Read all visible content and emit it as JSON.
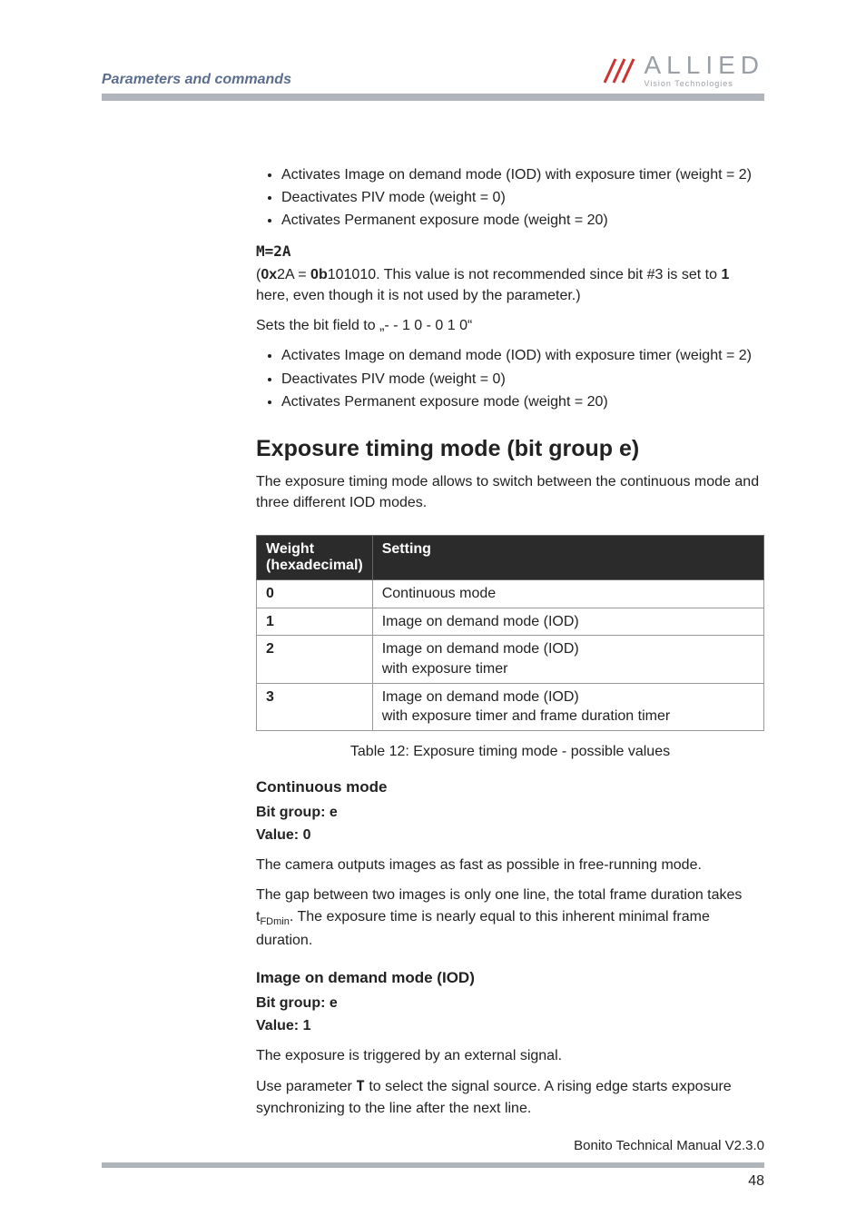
{
  "header": {
    "section": "Parameters and commands",
    "logo_top": "ALLIED",
    "logo_sub": "Vision Technologies"
  },
  "lists": {
    "top": [
      "Activates Image on demand mode (IOD) with exposure timer (weight = 2)",
      "Deactivates PIV mode (weight = 0)",
      "Activates Permanent exposure mode (weight = 20)"
    ],
    "second": [
      "Activates Image on demand mode (IOD) with exposure timer (weight = 2)",
      "Deactivates PIV mode (weight = 0)",
      "Activates Permanent exposure mode (weight = 20)"
    ]
  },
  "m2a": {
    "label": "M=2A",
    "note_pre": "(",
    "note_hex_prefix": "0x",
    "note_hex_rest": "2A = ",
    "note_bin_prefix": "0b",
    "note_bin_rest": "101010. This value is not recommended since bit #3 is set to ",
    "note_one": "1",
    "note_tail": " here, even though it is not used by the parameter.)",
    "sets": "Sets the bit field to „- - 1 0 - 0 1 0“"
  },
  "h2": "Exposure timing mode (bit group e)",
  "h2_desc": "The exposure timing mode allows to switch between the continuous mode and three different IOD modes.",
  "table": {
    "col1_a": "Weight",
    "col1_b": "(hexadecimal)",
    "col2": "Setting",
    "rows": [
      {
        "w": "0",
        "s": "Continuous mode"
      },
      {
        "w": "1",
        "s": "Image on demand mode (IOD)"
      },
      {
        "w": "2",
        "s": "Image on demand mode (IOD)\nwith exposure timer"
      },
      {
        "w": "3",
        "s": "Image on demand mode (IOD)\nwith exposure timer and frame duration timer"
      }
    ],
    "caption": "Table 12: Exposure timing mode - possible values"
  },
  "cont": {
    "title": "Continuous mode",
    "bitgroup": "Bit group: e",
    "value": "Value: 0",
    "p1": "The camera outputs images as fast as possible in free-running mode.",
    "p2a": "The gap between two images is only one line, the total frame duration takes t",
    "p2sub": "FDmin",
    "p2b": ". The exposure time is nearly equal to this inherent minimal frame duration."
  },
  "iod": {
    "title": "Image on demand mode (IOD)",
    "bitgroup": "Bit group: e",
    "value": "Value: 1",
    "p1": "The exposure is triggered by an external signal.",
    "p2a": "Use parameter ",
    "p2t": "T",
    "p2b": " to select the signal source. A rising edge starts exposure synchronizing to the line after the next line."
  },
  "footer": {
    "doc": "Bonito Technical Manual V2.3.0",
    "page": "48"
  }
}
